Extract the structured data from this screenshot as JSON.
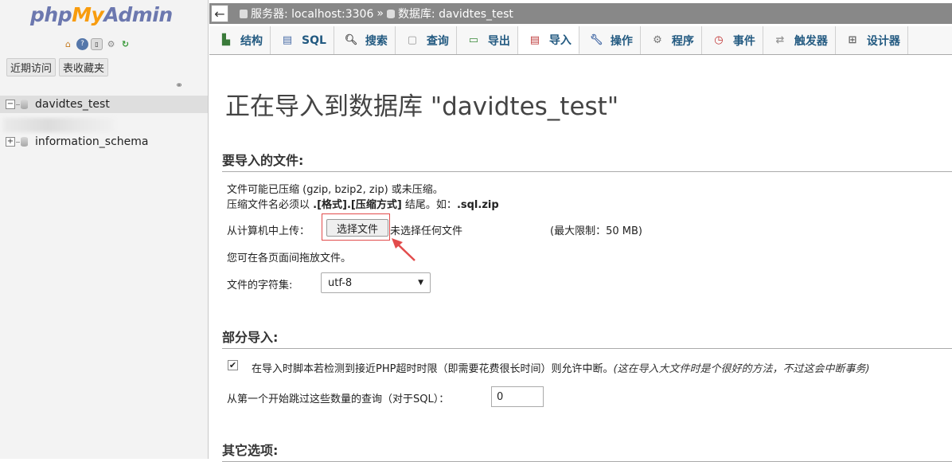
{
  "nav": {
    "logo_php": "php",
    "logo_my": "My",
    "logo_admin": "Admin",
    "icons": [
      "home-icon",
      "info-icon",
      "docs-icon",
      "settings-icon",
      "reload-icon"
    ],
    "recent_label": "近期访问",
    "favorites_label": "表收藏夹",
    "databases": [
      {
        "name": "davidtes_test",
        "expander": "−",
        "active": true
      },
      {
        "name": "information_schema",
        "expander": "+",
        "active": false
      }
    ]
  },
  "topbar": {
    "back_glyph": "←",
    "server_label": "服务器: localhost:3306",
    "separator": "»",
    "database_label": "数据库: davidtes_test"
  },
  "tabs": [
    {
      "label": "结构",
      "icon": "structure-icon"
    },
    {
      "label": "SQL",
      "icon": "sql-icon"
    },
    {
      "label": "搜索",
      "icon": "search-icon"
    },
    {
      "label": "查询",
      "icon": "query-icon"
    },
    {
      "label": "导出",
      "icon": "export-icon"
    },
    {
      "label": "导入",
      "icon": "import-icon",
      "active": true
    },
    {
      "label": "操作",
      "icon": "wrench-icon"
    },
    {
      "label": "程序",
      "icon": "routines-icon"
    },
    {
      "label": "事件",
      "icon": "clock-icon"
    },
    {
      "label": "触发器",
      "icon": "triggers-icon"
    },
    {
      "label": "设计器",
      "icon": "designer-icon"
    }
  ],
  "main": {
    "title": "正在导入到数据库 \"davidtes_test\"",
    "file_section": {
      "heading": "要导入的文件:",
      "compress_note": "文件可能已压缩 (gzip, bzip2, zip) 或未压缩。",
      "name_note_prefix": "压缩文件名必须以 ",
      "name_note_format": ".[格式].[压缩方式]",
      "name_note_middle": " 结尾。如：",
      "name_note_example": ".sql.zip",
      "upload_label": "从计算机中上传：",
      "choose_button": "选择文件",
      "no_file": "未选择任何文件",
      "max_limit": "(最大限制：50 MB)",
      "drag_note": "您可在各页面间拖放文件。",
      "charset_label": "文件的字符集:",
      "charset_value": "utf-8"
    },
    "partial_section": {
      "heading": "部分导入:",
      "interrupt_checked": true,
      "interrupt_label": "在导入时脚本若检测到接近PHP超时时限（即需要花费很长时间）则允许中断。",
      "interrupt_note": "(这在导入大文件时是个很好的方法，不过这会中断事务)",
      "skip_label": "从第一个开始跳过这些数量的查询（对于SQL）：",
      "skip_value": "0"
    },
    "other_section": {
      "heading": "其它选项:"
    }
  },
  "colors": {
    "tab_text": "#235a81",
    "topbar_bg": "#888888",
    "highlight_red": "#e24c4c"
  }
}
